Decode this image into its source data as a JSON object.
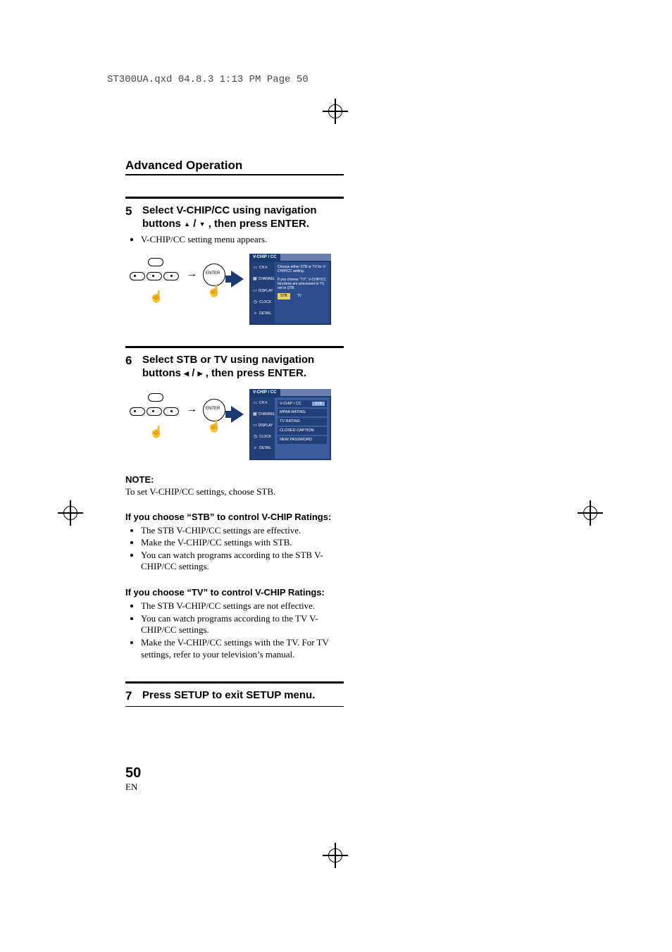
{
  "header_line": "ST300UA.qxd  04.8.3  1:13 PM  Page 50",
  "section_title": "Advanced Operation",
  "step5": {
    "num": "5",
    "title_a": "Select V-CHIP/CC using navigation",
    "title_b_prefix": "buttons ",
    "title_b_suffix": ", then press ENTER.",
    "bullet1": "V-CHIP/CC setting menu appears."
  },
  "remote_enter": "ENTER",
  "hand": "☝",
  "osd1": {
    "tab_on": "V-CHIP / CC",
    "side": {
      "i0": "CH.#",
      "i1": "CHANNEL",
      "i2": "DISPLAY",
      "i3": "CLOCK",
      "i4": "DETAIL"
    },
    "ico": {
      "i0": "▭",
      "i1": "▦",
      "i2": "▭",
      "i3": "◷",
      "i4": "⌕"
    },
    "line1": "Choose either STB or TV for V-CHIP/CC setting.",
    "line2": "If you choose \"TV\", V-CHIP/CC functions are processed in TV, not in STB.",
    "btn_stb": "STB",
    "btn_tv": "TV"
  },
  "step6": {
    "num": "6",
    "title_a": "Select STB or TV using navigation",
    "title_b_prefix": "buttons ",
    "title_b_suffix": ", then press ENTER."
  },
  "osd2": {
    "tab_on": "V-CHIP / CC",
    "side": {
      "i0": "CH.#",
      "i1": "CHANNEL",
      "i2": "DISPLAY",
      "i3": "CLOCK",
      "i4": "DETAIL"
    },
    "ico": {
      "i0": "▭",
      "i1": "▦",
      "i2": "▭",
      "i3": "◷",
      "i4": "⌕"
    },
    "row0": "V-CHIP / CC",
    "row0_val": "STB",
    "row1": "MPAA RATING",
    "row2": "TV RATING",
    "row3": "CLOSED CAPTION",
    "row4": "NEW PASSWORD"
  },
  "note": {
    "heading": "NOTE:",
    "body": "To set V-CHIP/CC settings, choose STB."
  },
  "stb": {
    "heading": "If you choose “STB” to control V-CHIP Ratings:",
    "b1": "The STB V-CHIP/CC settings are effective.",
    "b2": "Make the V-CHIP/CC settings with STB.",
    "b3": "You can watch programs according to the STB V-CHIP/CC settings."
  },
  "tv": {
    "heading": "If you choose “TV” to control V-CHIP Ratings:",
    "b1": "The STB V-CHIP/CC settings are not effective.",
    "b2": "You can watch programs according to the TV V-CHIP/CC settings.",
    "b3": "Make the V-CHIP/CC settings with the TV. For TV settings, refer to your television’s manual."
  },
  "step7": {
    "num": "7",
    "title": "Press SETUP to exit SETUP menu."
  },
  "page_number": "50",
  "page_lang": "EN"
}
